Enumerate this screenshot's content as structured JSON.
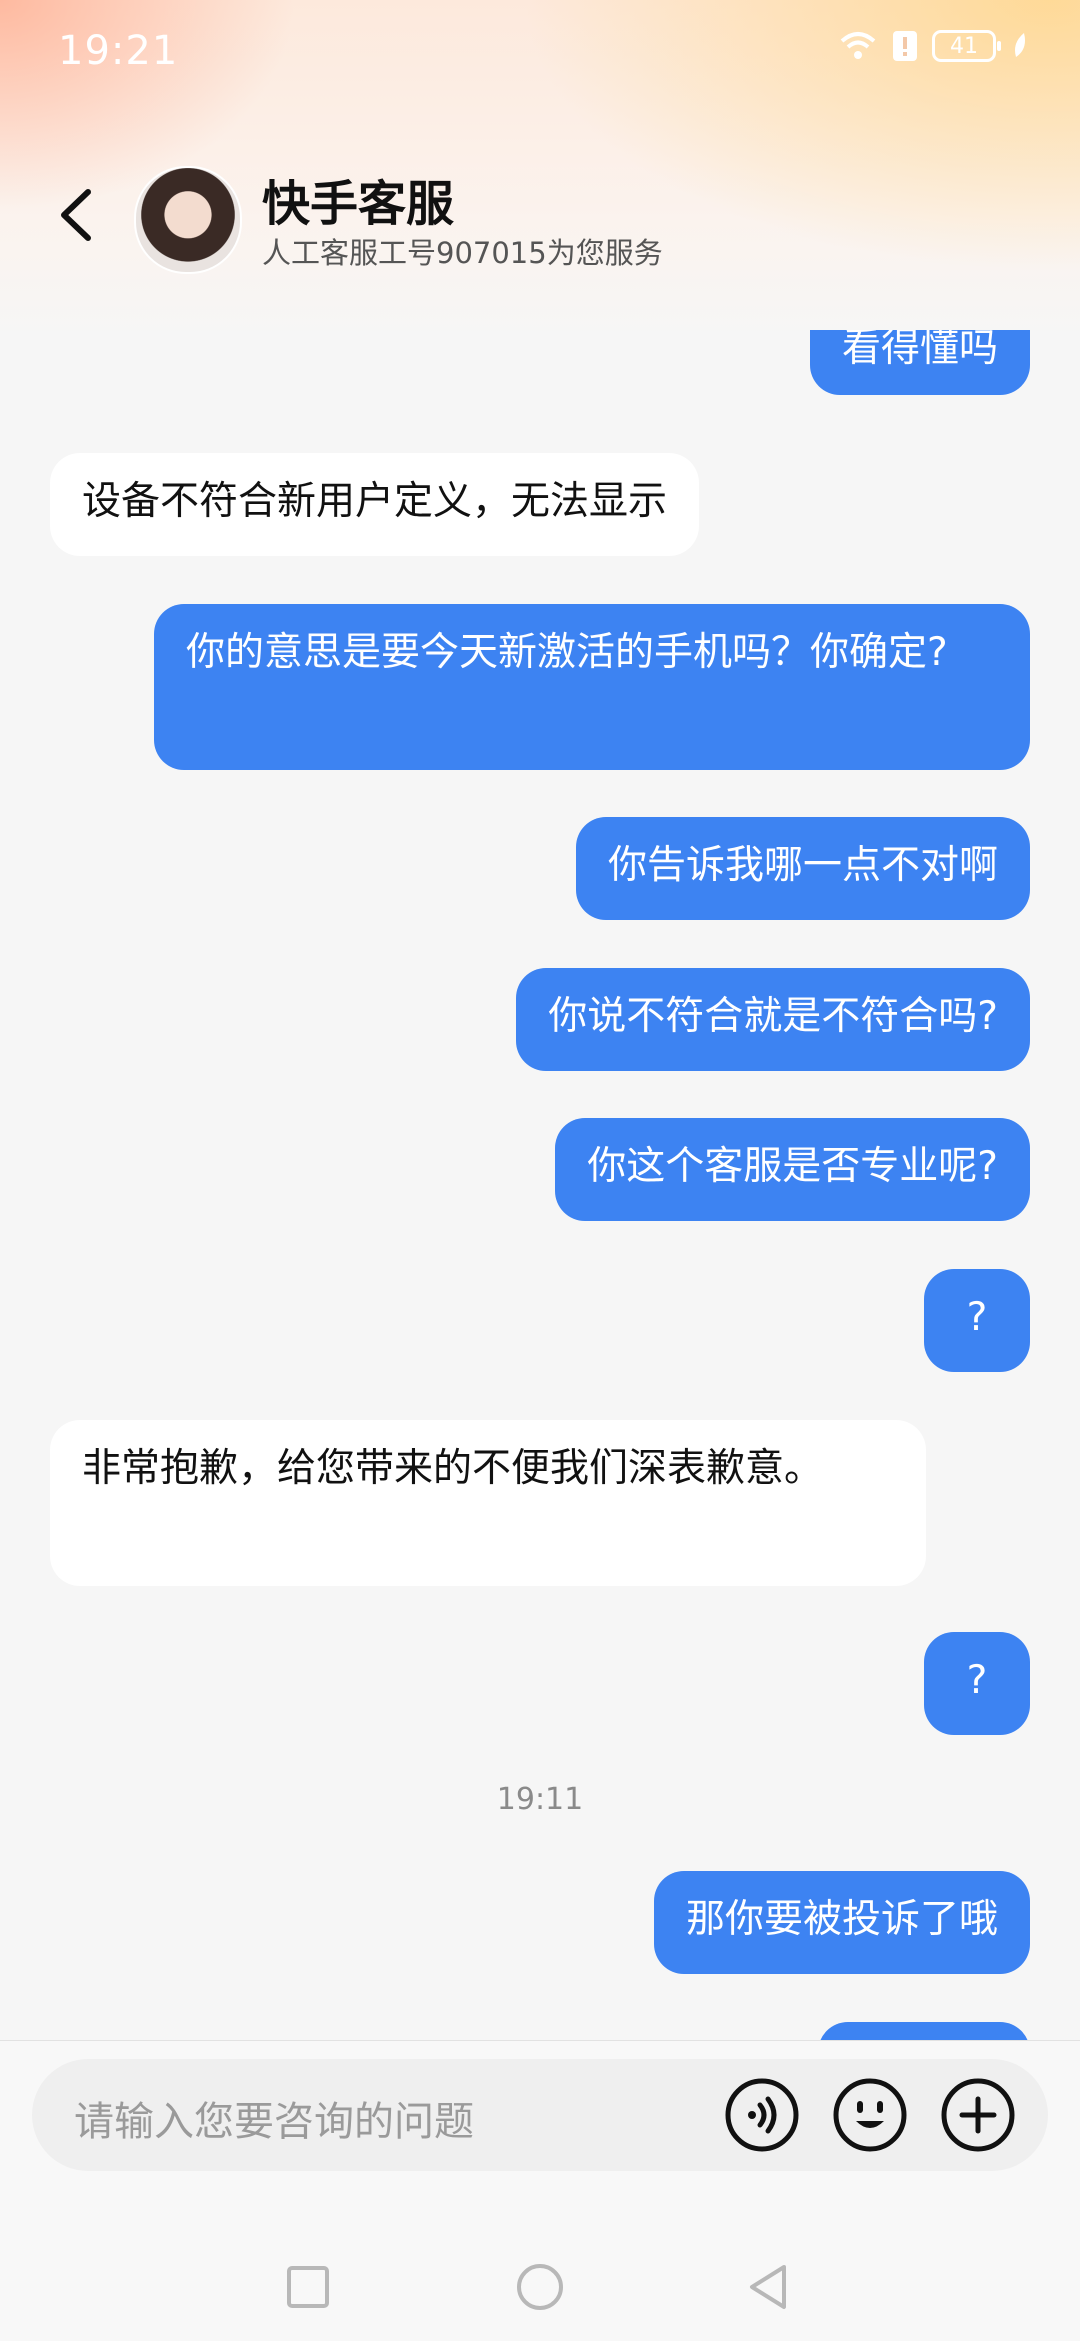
{
  "status_bar": {
    "time": "19:21",
    "battery": "41"
  },
  "header": {
    "title": "快手客服",
    "subtitle": "人工客服工号907015为您服务"
  },
  "messages": [
    {
      "from": "me",
      "text": "看得懂吗"
    },
    {
      "from": "them",
      "text": "设备不符合新用户定义，无法显示"
    },
    {
      "from": "me",
      "text": "你的意思是要今天新激活的手机吗？你确定?"
    },
    {
      "from": "me",
      "text": "你告诉我哪一点不对啊"
    },
    {
      "from": "me",
      "text": "你说不符合就是不符合吗?"
    },
    {
      "from": "me",
      "text": "你这个客服是否专业呢?"
    },
    {
      "from": "me",
      "text": "?"
    },
    {
      "from": "them",
      "text": "非常抱歉，给您带来的不便我们深表歉意。"
    },
    {
      "from": "me",
      "text": "?"
    },
    {
      "timestamp": "19:11"
    },
    {
      "from": "me",
      "text": "那你要被投诉了哦"
    }
  ],
  "input": {
    "placeholder": "请输入您要咨询的问题"
  },
  "icons": {
    "back": "back-arrow-icon",
    "voice": "voice-icon",
    "emoji": "emoji-icon",
    "plus": "plus-icon"
  },
  "colors": {
    "my_bubble": "#3d83f2",
    "their_bubble": "#ffffff"
  }
}
